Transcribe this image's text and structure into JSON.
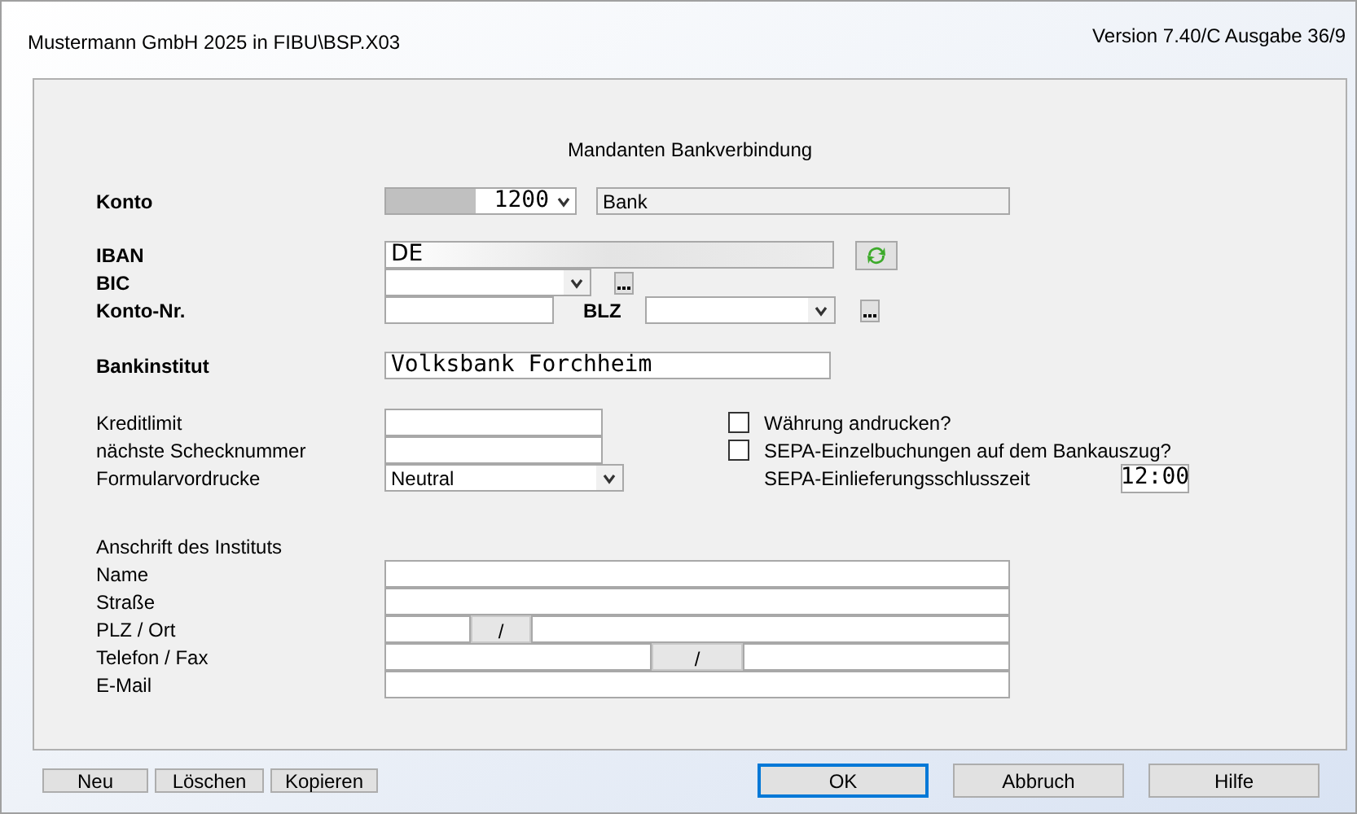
{
  "window": {
    "title": "Mustermann GmbH 2025 in FIBU\\BSP.X03",
    "version": "Version 7.40/C Ausgabe 36/9"
  },
  "form": {
    "title": "Mandanten Bankverbindung",
    "konto": {
      "label": "Konto",
      "number": "1200",
      "name": "Bank"
    },
    "iban": {
      "label": "IBAN",
      "value": "DE"
    },
    "bic": {
      "label": "BIC"
    },
    "konto_nr": {
      "label": "Konto-Nr."
    },
    "blz": {
      "label": "BLZ"
    },
    "bankinstitut": {
      "label": "Bankinstitut",
      "value": "Volksbank Forchheim"
    },
    "kreditlimit": {
      "label": "Kreditlimit"
    },
    "schecknummer": {
      "label": "nächste Schecknummer"
    },
    "formularvordrucke": {
      "label": "Formularvordrucke",
      "value": "Neutral"
    },
    "checkboxes": [
      {
        "label": "Währung andrucken?",
        "checked": false
      },
      {
        "label": "SEPA-Einzelbuchungen auf dem Bankauszug?",
        "checked": false
      }
    ],
    "sepa_time": {
      "label": "SEPA-Einlieferungsschlusszeit",
      "value": "12:00"
    },
    "address": {
      "heading": "Anschrift des Instituts",
      "name": "Name",
      "street": "Straße",
      "plz_ort": "PLZ / Ort",
      "separator_1": "/",
      "phone_fax": "Telefon / Fax",
      "separator_2": "/",
      "email": "E-Mail"
    }
  },
  "buttons_left": [
    "Neu",
    "Löschen",
    "Kopieren"
  ],
  "buttons_right": [
    {
      "label": "OK",
      "default": true
    },
    {
      "label": "Abbruch",
      "default": false
    },
    {
      "label": "Hilfe",
      "default": false
    }
  ]
}
